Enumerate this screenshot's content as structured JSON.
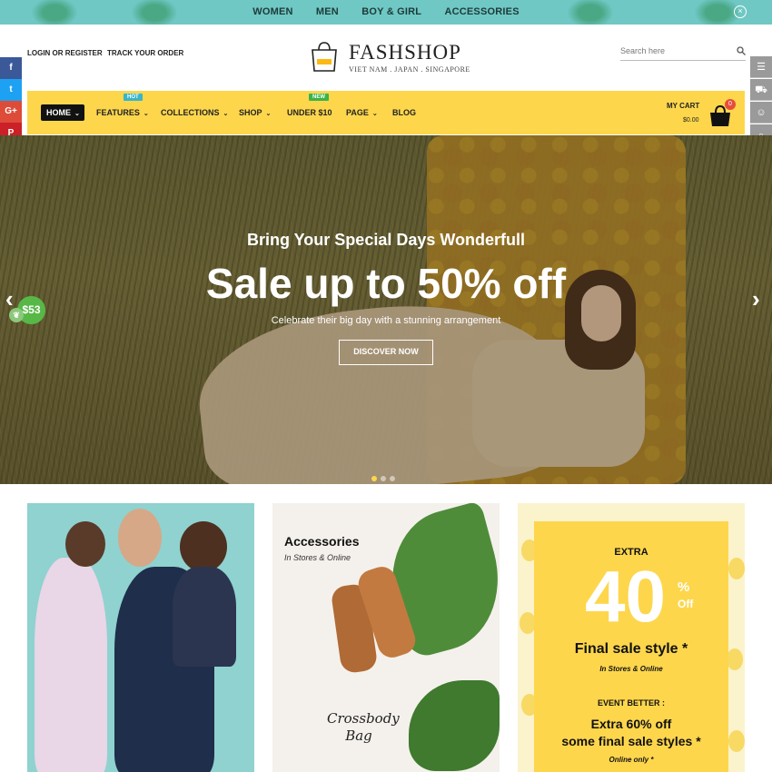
{
  "topbar": {
    "categories": [
      "WOMEN",
      "MEN",
      "BOY & GIRL",
      "ACCESSORIES"
    ],
    "close_glyph": "×"
  },
  "header": {
    "login_label": "LOGIN OR REGISTER",
    "track_label": "TRACK YOUR ORDER",
    "brand": "FASHSHOP",
    "tagline": "VIET NAM . JAPAN . SINGAPORE",
    "search_placeholder": "Search here"
  },
  "nav": {
    "home": "HOME",
    "items": [
      "FEATURES",
      "COLLECTIONS",
      "SHOP",
      "UNDER $10",
      "PAGE",
      "BLOG"
    ],
    "badge_hot": "HOT",
    "badge_new": "NEW",
    "cart_label": "MY CART",
    "cart_amount": "$0.00",
    "cart_count": "0",
    "accent": "#fdd64c"
  },
  "social": [
    {
      "icon": "facebook-icon",
      "glyph": "f",
      "color": "#3b5998"
    },
    {
      "icon": "twitter-icon",
      "glyph": "t",
      "color": "#1da1f2"
    },
    {
      "icon": "google-plus-icon",
      "glyph": "G+",
      "color": "#dd4b39"
    },
    {
      "icon": "pinterest-icon",
      "glyph": "P",
      "color": "#cb2027"
    },
    {
      "icon": "instagram-icon",
      "glyph": "◎",
      "color": "#e1306c"
    }
  ],
  "tools": [
    "sliders-icon",
    "cart-icon",
    "users-icon",
    "search-icon",
    "sun-icon"
  ],
  "hero": {
    "subtitle": "Bring Your Special Days Wonderfull",
    "headline": "Sale up to 50% off",
    "caption": "Celebrate their big day with a stunning arrangement",
    "cta": "DISCOVER NOW",
    "active_slide": 1,
    "slide_count": 3
  },
  "price_bubble": "$53",
  "banner_accessories": {
    "title": "Accessories",
    "sub": "In Stores & Online",
    "script": "Crossbody Bag"
  },
  "banner_sale": {
    "extra": "EXTRA",
    "big": "40",
    "pct": "%",
    "off": "Off",
    "line1": "Final sale style *",
    "line1_sub": "In Stores & Online",
    "event": "EVENT BETTER :",
    "line2": "Extra 60% off",
    "line3": "some final sale styles *",
    "line4": "Online only *"
  }
}
